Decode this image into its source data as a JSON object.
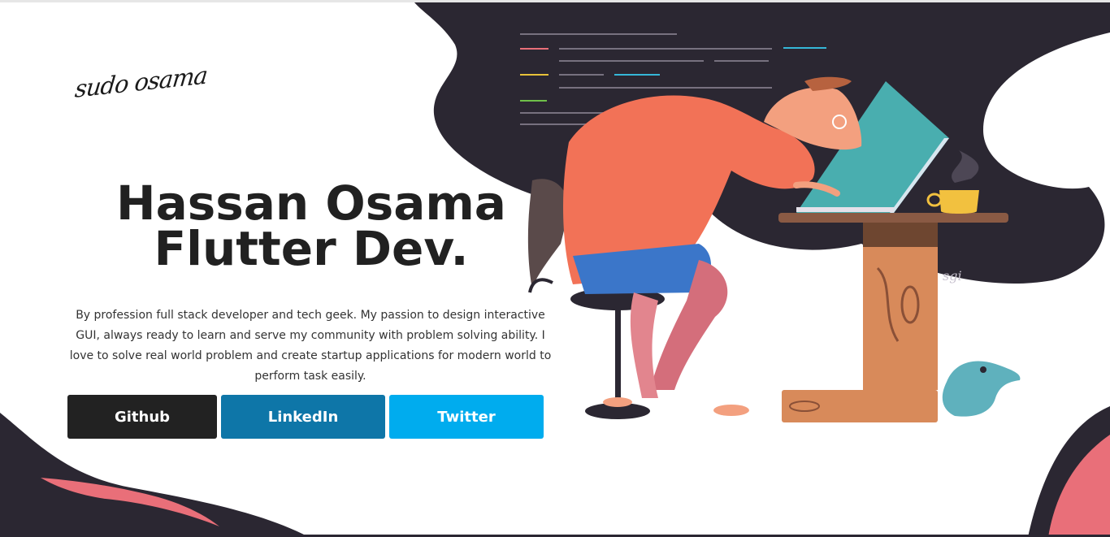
{
  "brand": {
    "logo_text": "sudo osama"
  },
  "hero": {
    "title_line1": "Hassan Osama",
    "title_line2": "Flutter Dev.",
    "description": "By profession full stack developer and tech geek. My passion to design interactive GUI, always ready to learn and serve my community with problem solving ability. I love to solve real world problem and create startup applications for modern world to perform task easily."
  },
  "buttons": {
    "github": {
      "label": "Github",
      "color": "#222222"
    },
    "linkedin": {
      "label": "LinkedIn",
      "color": "#0e76a8"
    },
    "twitter": {
      "label": "Twitter",
      "color": "#00acee"
    }
  },
  "theme": {
    "dark_blob": "#2b2732",
    "pink_accent": "#e96f79"
  },
  "illustration": {
    "name": "developer-at-laptop-illustration",
    "signature": "sgi"
  }
}
